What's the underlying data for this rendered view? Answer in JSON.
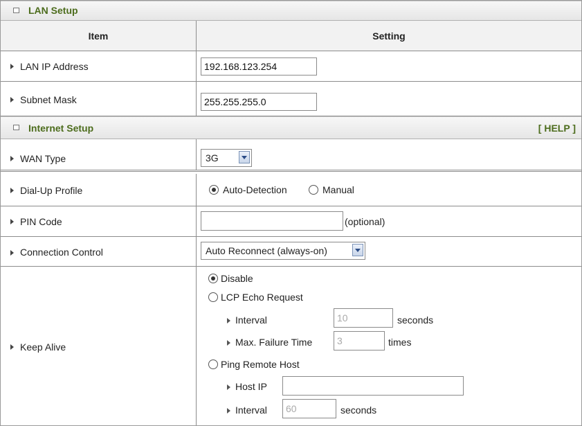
{
  "lan_section": {
    "title": "LAN Setup"
  },
  "header": {
    "item": "Item",
    "setting": "Setting"
  },
  "lan_ip": {
    "label": "LAN IP Address",
    "value": "192.168.123.254"
  },
  "subnet": {
    "label": "Subnet Mask",
    "value": "255.255.255.0"
  },
  "internet_section": {
    "title": "Internet Setup",
    "help": "[ HELP ]"
  },
  "wan_type": {
    "label": "WAN Type",
    "value": "3G"
  },
  "dialup": {
    "label": "Dial-Up Profile",
    "option_auto": "Auto-Detection",
    "option_manual": "Manual",
    "selected": "Auto-Detection"
  },
  "pin": {
    "label": "PIN Code",
    "value": "",
    "suffix": "(optional)"
  },
  "connection": {
    "label": "Connection Control",
    "value": "Auto Reconnect (always-on)"
  },
  "keepalive": {
    "label": "Keep Alive",
    "selected": "Disable",
    "disable": "Disable",
    "lcp": "LCP Echo Request",
    "lcp_interval_label": "Interval",
    "lcp_interval_value": "10",
    "lcp_interval_unit": "seconds",
    "lcp_fail_label": "Max. Failure Time",
    "lcp_fail_value": "3",
    "lcp_fail_unit": "times",
    "ping": "Ping Remote Host",
    "host_ip_label": "Host IP",
    "host_ip_value": "",
    "ping_interval_label": "Interval",
    "ping_interval_value": "60",
    "ping_interval_unit": "seconds"
  }
}
